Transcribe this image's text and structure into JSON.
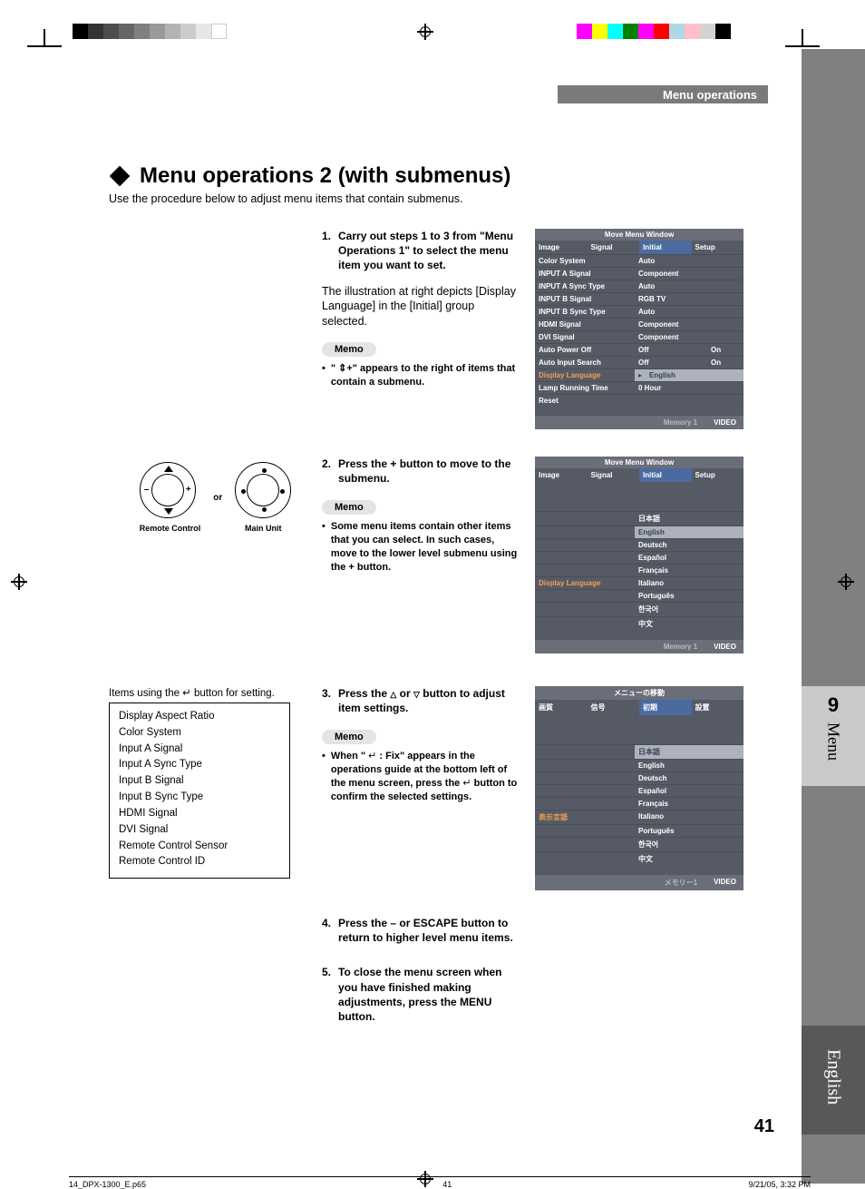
{
  "header": {
    "section": "Menu operations"
  },
  "title": "Menu operations 2 (with submenus)",
  "subtitle": "Use the procedure below to adjust menu items that contain submenus.",
  "steps": {
    "s1": {
      "num": "1.",
      "text": "Carry out steps 1 to 3 from \"Menu Operations 1\" to select the menu item you want to set."
    },
    "s1_para": "The illustration at right depicts [Display Language] in the [Initial] group selected.",
    "s2": {
      "num": "2.",
      "text": "Press the + button to move to the submenu."
    },
    "s3": {
      "num": "3.",
      "text_a": "Press the ",
      "text_b": " or ",
      "text_c": " button to adjust item settings."
    },
    "s4": {
      "num": "4.",
      "text": "Press the – or ESCAPE button to return to higher level menu items."
    },
    "s5": {
      "num": "5.",
      "text": "To close the menu screen when you have finished making adjustments, press the MENU button."
    }
  },
  "memo_label": "Memo",
  "memo1": "\" ⇕+\" appears to the right of items that contain a submenu.",
  "memo2": "Some menu items contain other items that you can select. In such cases, move to the lower level submenu using the + button.",
  "memo3_a": "When \" ",
  "memo3_b": " : Fix\" appears in the operations guide at the bottom left of the menu screen, press the ",
  "memo3_c": " button to confirm the selected settings.",
  "controls": {
    "or": "or",
    "remote": "Remote Control",
    "main": "Main Unit"
  },
  "items_header": "Items using the ↵ button for setting.",
  "items": [
    "Display Aspect Ratio",
    "Color System",
    "Input A Signal",
    "Input A Sync Type",
    "Input B Signal",
    "Input B Sync Type",
    "HDMI Signal",
    "DVI Signal",
    "Remote Control Sensor",
    "Remote Control ID"
  ],
  "osd1": {
    "title": "Move Menu Window",
    "tabs": [
      "Image",
      "Signal",
      "Initial",
      "Setup"
    ],
    "rows": [
      {
        "k": "Color System",
        "v": "Auto"
      },
      {
        "k": "INPUT A Signal",
        "v": "Component"
      },
      {
        "k": "INPUT A Sync Type",
        "v": "Auto"
      },
      {
        "k": "INPUT B Signal",
        "v": "RGB TV"
      },
      {
        "k": "INPUT B Sync Type",
        "v": "Auto"
      },
      {
        "k": "HDMI Signal",
        "v": "Component"
      },
      {
        "k": "DVI Signal",
        "v": "Component"
      },
      {
        "k": "Auto Power Off",
        "v": "Off",
        "v2": "On"
      },
      {
        "k": "Auto Input Search",
        "v": "Off",
        "v2": "On"
      },
      {
        "k": "Display Language",
        "v": "English",
        "hl": true
      },
      {
        "k": "Lamp Running Time",
        "v": "0 Hour"
      },
      {
        "k": "Reset",
        "v": ""
      }
    ],
    "foot": {
      "mem": "Memory 1",
      "src": "VIDEO"
    }
  },
  "osd2": {
    "title": "Move Menu Window",
    "tabs": [
      "Image",
      "Signal",
      "Initial",
      "Setup"
    ],
    "label": "Display Language",
    "langs": [
      "日本語",
      "English",
      "Deutsch",
      "Español",
      "Français",
      "Italiano",
      "Português",
      "한국어",
      "中文"
    ],
    "sel_index": 1,
    "foot": {
      "mem": "Memory 1",
      "src": "VIDEO"
    }
  },
  "osd3": {
    "title": "メニューの移動",
    "tabs": [
      "画質",
      "信号",
      "初期",
      "設置"
    ],
    "label": "表示言語",
    "langs": [
      "日本語",
      "English",
      "Deutsch",
      "Español",
      "Français",
      "Italiano",
      "Português",
      "한국어",
      "中文"
    ],
    "sel_index": 0,
    "foot": {
      "mem": "メモリー1",
      "src": "VIDEO"
    }
  },
  "side": {
    "chapter_num": "9",
    "chapter_label": "Menu",
    "lang": "English"
  },
  "page_num": "41",
  "footer": {
    "file": "14_DPX-1300_E.p65",
    "page": "41",
    "date": "9/21/05, 3:32 PM"
  }
}
